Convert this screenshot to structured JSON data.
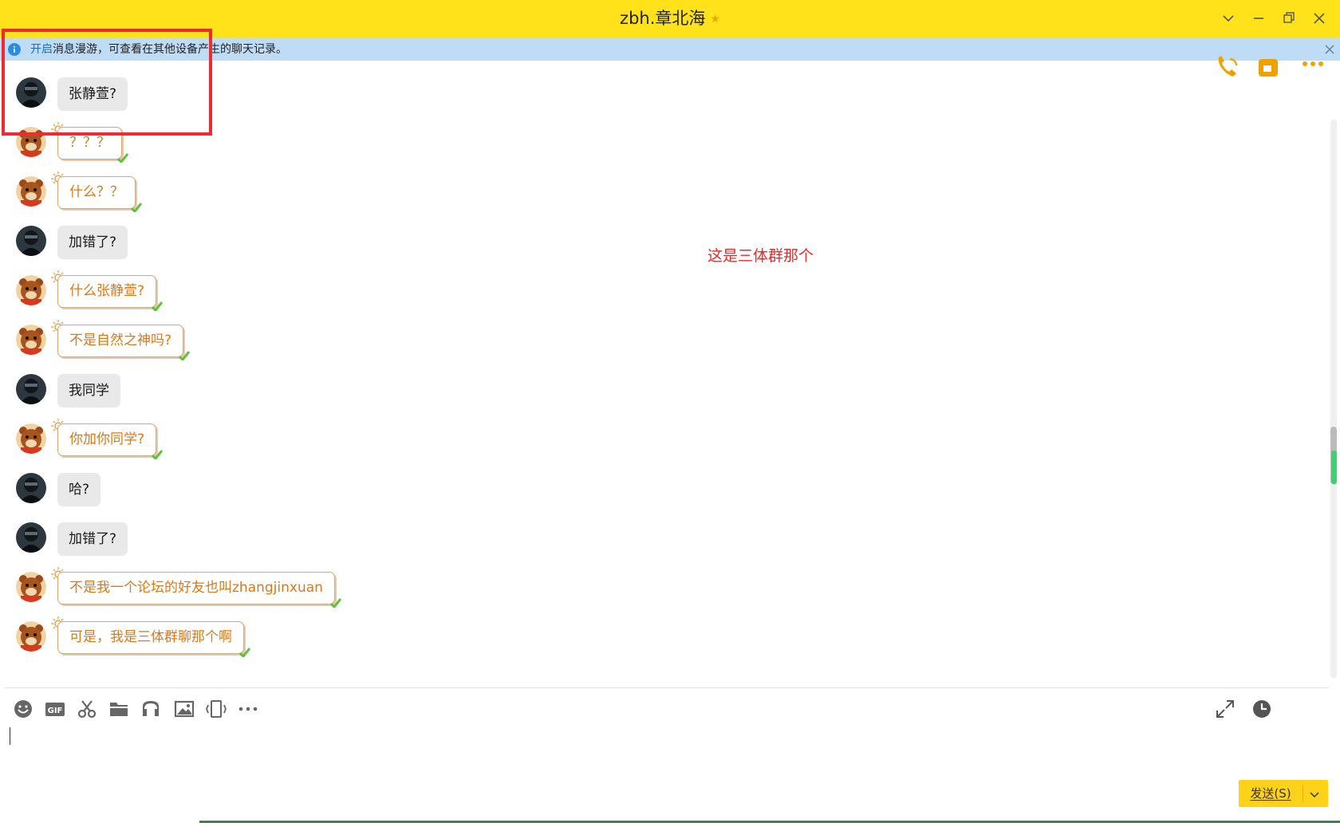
{
  "window": {
    "title": "zbh.章北海",
    "title_badge": "★"
  },
  "infobar": {
    "link": "开启",
    "text": "消息漫游，可查看在其他设备产生的聊天记录。"
  },
  "annotation": "这是三体群那个",
  "messages": [
    {
      "sender": "them",
      "text": "张静萱?"
    },
    {
      "sender": "me",
      "text": "？？？"
    },
    {
      "sender": "me",
      "text": "什么？？"
    },
    {
      "sender": "them",
      "text": "加错了?"
    },
    {
      "sender": "me",
      "text": "什么张静萱?"
    },
    {
      "sender": "me",
      "text": "不是自然之神吗?"
    },
    {
      "sender": "them",
      "text": "我同学"
    },
    {
      "sender": "me",
      "text": "你加你同学?"
    },
    {
      "sender": "them",
      "text": "哈?"
    },
    {
      "sender": "them",
      "text": "加错了?"
    },
    {
      "sender": "me",
      "text": "不是我一个论坛的好友也叫zhangjinxuan"
    },
    {
      "sender": "me",
      "text": "可是，我是三体群聊那个啊"
    }
  ],
  "toolbar": {
    "icons": [
      "emoji-icon",
      "gif-icon",
      "scissors-icon",
      "folder-icon",
      "music-icon",
      "image-icon",
      "shake-icon",
      "more-icon"
    ]
  },
  "send": {
    "label": "发送(S)"
  },
  "colors": {
    "titlebar": "#ffe21a",
    "infobar": "#bfdcf7",
    "annotation_red": "#e22c2c",
    "my_text": "#d9791b",
    "send_button": "#ffd21a"
  }
}
